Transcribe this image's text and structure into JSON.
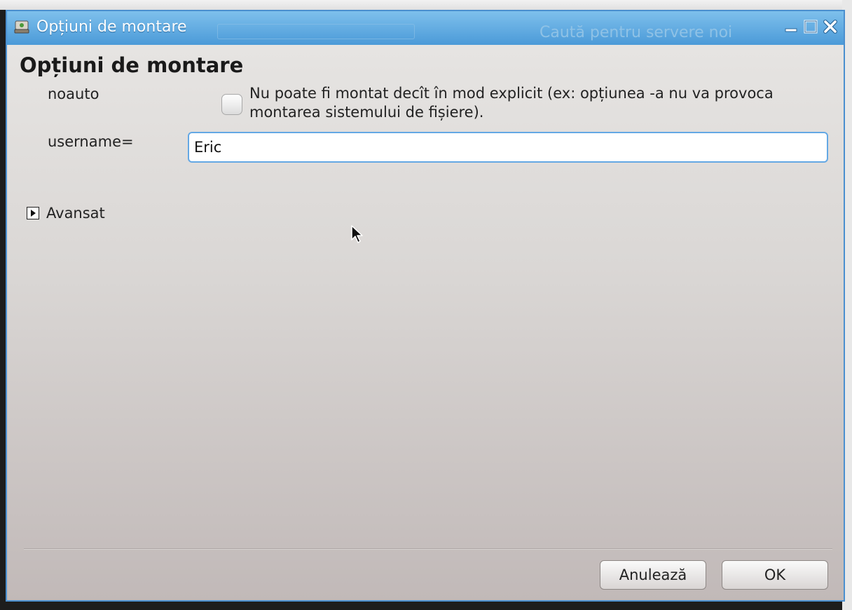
{
  "window": {
    "title": "Opțiuni de montare",
    "background_text": "Caută pentru servere noi"
  },
  "dialog": {
    "heading": "Opțiuni de montare",
    "noauto": {
      "label": "noauto",
      "checked": false,
      "description": "Nu poate fi montat decît în mod explicit (ex: opțiunea -a nu va provoca montarea sistemului de fișiere)."
    },
    "username": {
      "label": "username=",
      "value": "Eric"
    },
    "advanced": {
      "label": "Avansat",
      "expanded": false
    }
  },
  "buttons": {
    "cancel": "Anulează",
    "ok": "OK"
  },
  "colors": {
    "titlebar": "#4b9ad8",
    "focus": "#64a8e4"
  },
  "icons": {
    "app": "app-drive-icon",
    "minimize": "minimize-icon",
    "maximize": "maximize-icon",
    "close": "close-icon",
    "expander": "triangle-right-icon"
  }
}
